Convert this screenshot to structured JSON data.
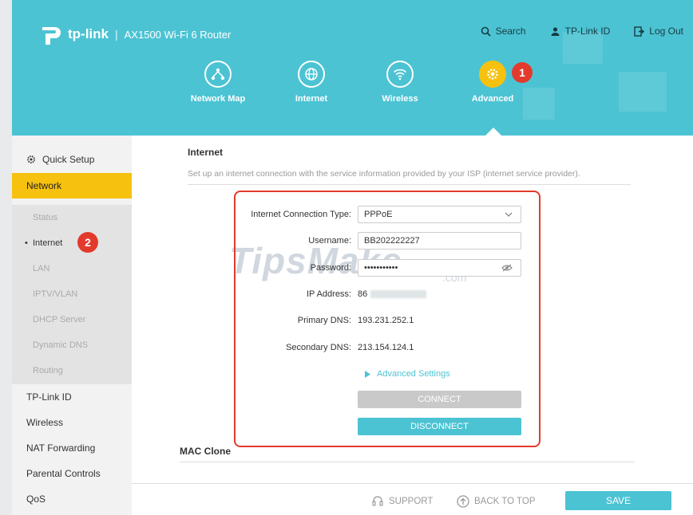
{
  "header": {
    "brand": "tp-link",
    "separator": "|",
    "model": "AX1500 Wi-Fi 6 Router",
    "links": {
      "search": "Search",
      "tplink_id": "TP-Link ID",
      "logout": "Log Out"
    },
    "nav": [
      {
        "label": "Network Map",
        "icon": "network-map-icon"
      },
      {
        "label": "Internet",
        "icon": "globe-icon"
      },
      {
        "label": "Wireless",
        "icon": "wifi-icon"
      },
      {
        "label": "Advanced",
        "icon": "gear-icon",
        "active": true
      }
    ],
    "callout_1": "1"
  },
  "sidebar": {
    "quick_setup": "Quick Setup",
    "network": "Network",
    "sub": [
      "Status",
      "Internet",
      "LAN",
      "IPTV/VLAN",
      "DHCP Server",
      "Dynamic DNS",
      "Routing"
    ],
    "callout_2": "2",
    "items": [
      "TP-Link ID",
      "Wireless",
      "NAT Forwarding",
      "Parental Controls",
      "QoS"
    ]
  },
  "main": {
    "title": "Internet",
    "description": "Set up an internet connection with the service information provided by your ISP (internet service provider).",
    "form": {
      "conn_type_label": "Internet Connection Type:",
      "conn_type_value": "PPPoE",
      "username_label": "Username:",
      "username_value": "BB202222227",
      "password_label": "Password:",
      "password_value": "•••••••••••",
      "ip_label": "IP Address:",
      "ip_value": "86",
      "primary_dns_label": "Primary DNS:",
      "primary_dns_value": "193.231.252.1",
      "secondary_dns_label": "Secondary DNS:",
      "secondary_dns_value": "213.154.124.1",
      "advanced_settings": "Advanced Settings",
      "connect": "CONNECT",
      "disconnect": "DISCONNECT"
    },
    "mac_clone_title": "MAC Clone",
    "watermark": "TipsMake",
    "watermark_suffix": ".com"
  },
  "footer": {
    "support": "SUPPORT",
    "back_to_top": "BACK TO TOP",
    "save": "SAVE"
  },
  "colors": {
    "teal": "#4cc3d3",
    "accent_yellow": "#f6c10f",
    "highlight_red": "#e23a2c"
  }
}
